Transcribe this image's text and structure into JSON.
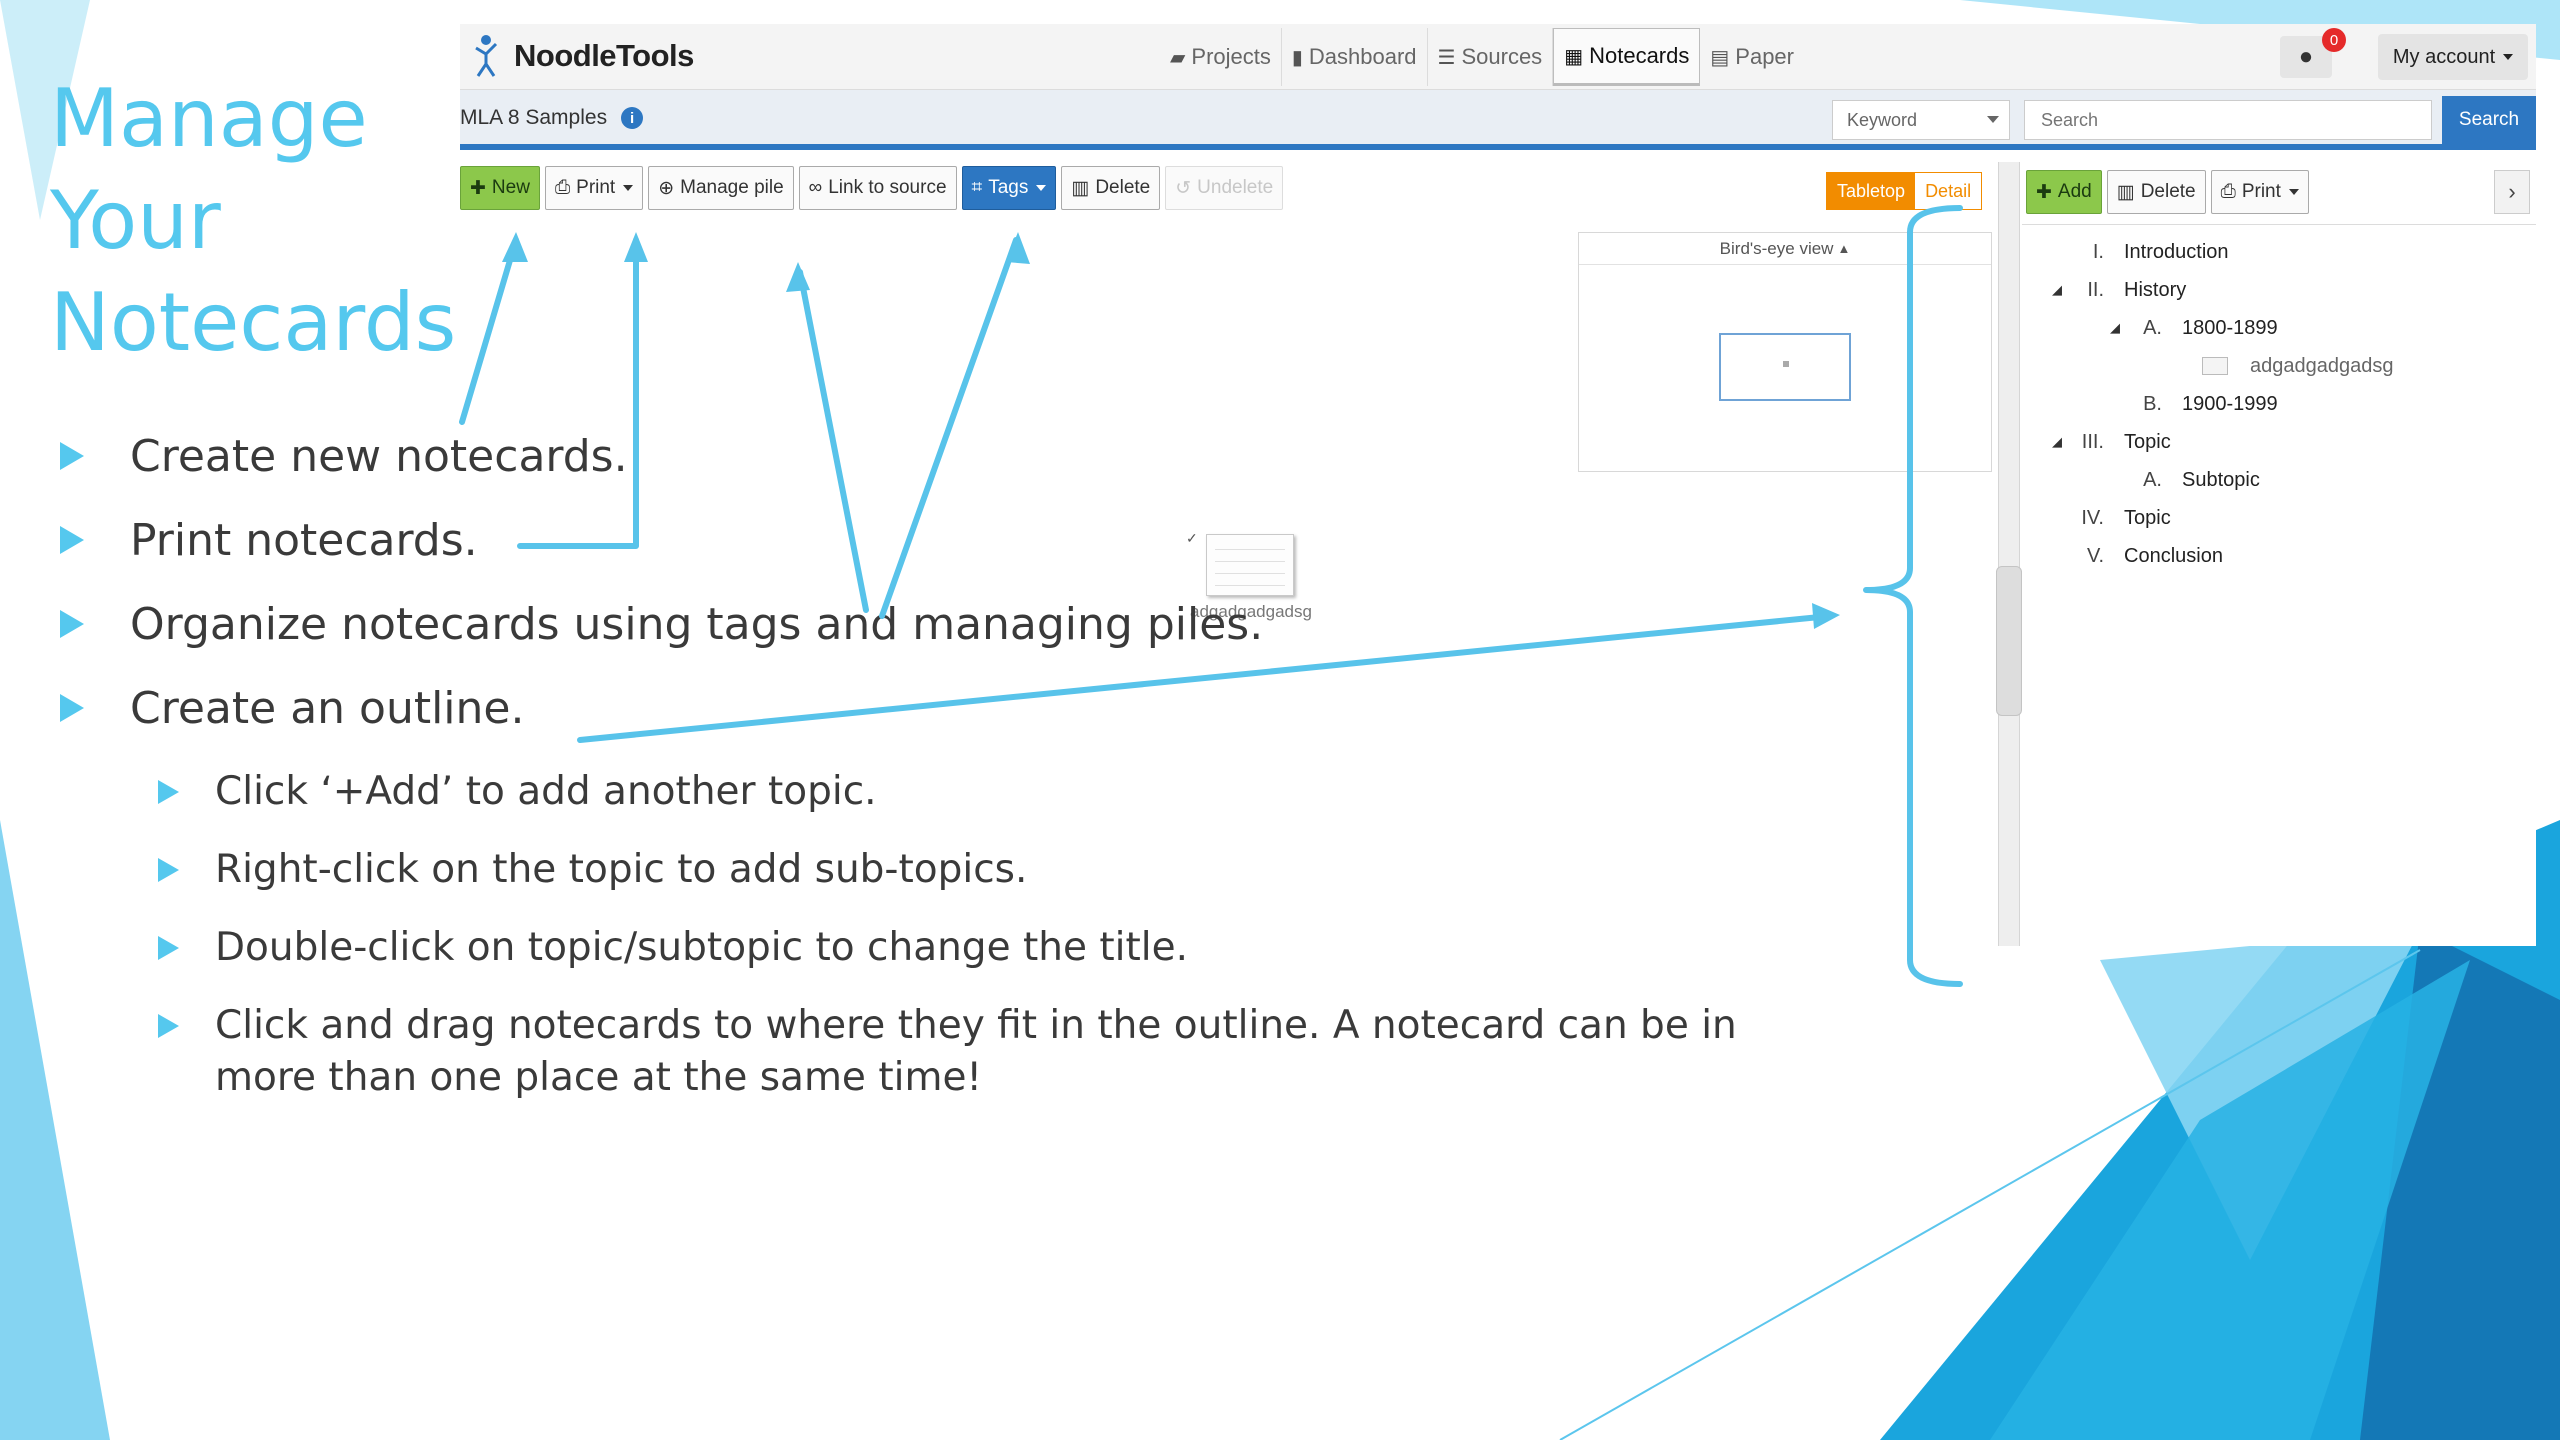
{
  "slide": {
    "title_lines": [
      "Manage",
      "Your",
      "Notecards"
    ],
    "bullets": [
      "Create new notecards.",
      "Print notecards.",
      "Organize notecards using tags and managing piles.",
      "Create an outline."
    ],
    "sub_bullets": [
      "Click ‘+Add’ to add another topic.",
      "Right-click on the topic to add sub-topics.",
      "Double-click on topic/subtopic to change the title.",
      "Click and drag notecards to where they fit in the outline.  A notecard can be in more than one place at the same time!"
    ],
    "accent_color": "#55c8ee"
  },
  "app": {
    "logo_text": "NoodleTools",
    "nav_tabs": [
      {
        "label": "Projects",
        "icon": "folder-icon"
      },
      {
        "label": "Dashboard",
        "icon": "bar-chart-icon"
      },
      {
        "label": "Sources",
        "icon": "list-icon"
      },
      {
        "label": "Notecards",
        "icon": "grid-icon",
        "active": true
      },
      {
        "label": "Paper",
        "icon": "document-icon"
      }
    ],
    "chat_badge": "0",
    "account_label": "My account",
    "project_name": "MLA 8 Samples",
    "search": {
      "select_value": "Keyword",
      "placeholder": "Search",
      "button": "Search"
    },
    "toolbar": {
      "new": "New",
      "print": "Print",
      "manage_pile": "Manage pile",
      "link_to_source": "Link to source",
      "tags": "Tags",
      "delete": "Delete",
      "undelete": "Undelete"
    },
    "view_toggle": {
      "tabletop": "Tabletop",
      "detail": "Detail"
    },
    "birds_eye_label": "Bird's-eye view",
    "notecard_title": "adgadgadgadsg",
    "outline_toolbar": {
      "add": "Add",
      "delete": "Delete",
      "print": "Print"
    },
    "outline": [
      {
        "num": "I.",
        "label": "Introduction"
      },
      {
        "num": "II.",
        "label": "History"
      },
      {
        "num": "A.",
        "label": "1800-1899"
      },
      {
        "num": "",
        "label": "adgadgadgadsg"
      },
      {
        "num": "B.",
        "label": "1900-1999"
      },
      {
        "num": "III.",
        "label": "Topic"
      },
      {
        "num": "A.",
        "label": "Subtopic"
      },
      {
        "num": "IV.",
        "label": "Topic"
      },
      {
        "num": "V.",
        "label": "Conclusion"
      }
    ],
    "colors": {
      "brand_blue": "#2d77c2",
      "new_green": "#8cc84b",
      "tabletop_orange": "#f28c00",
      "badge_red": "#e52a2a"
    }
  }
}
